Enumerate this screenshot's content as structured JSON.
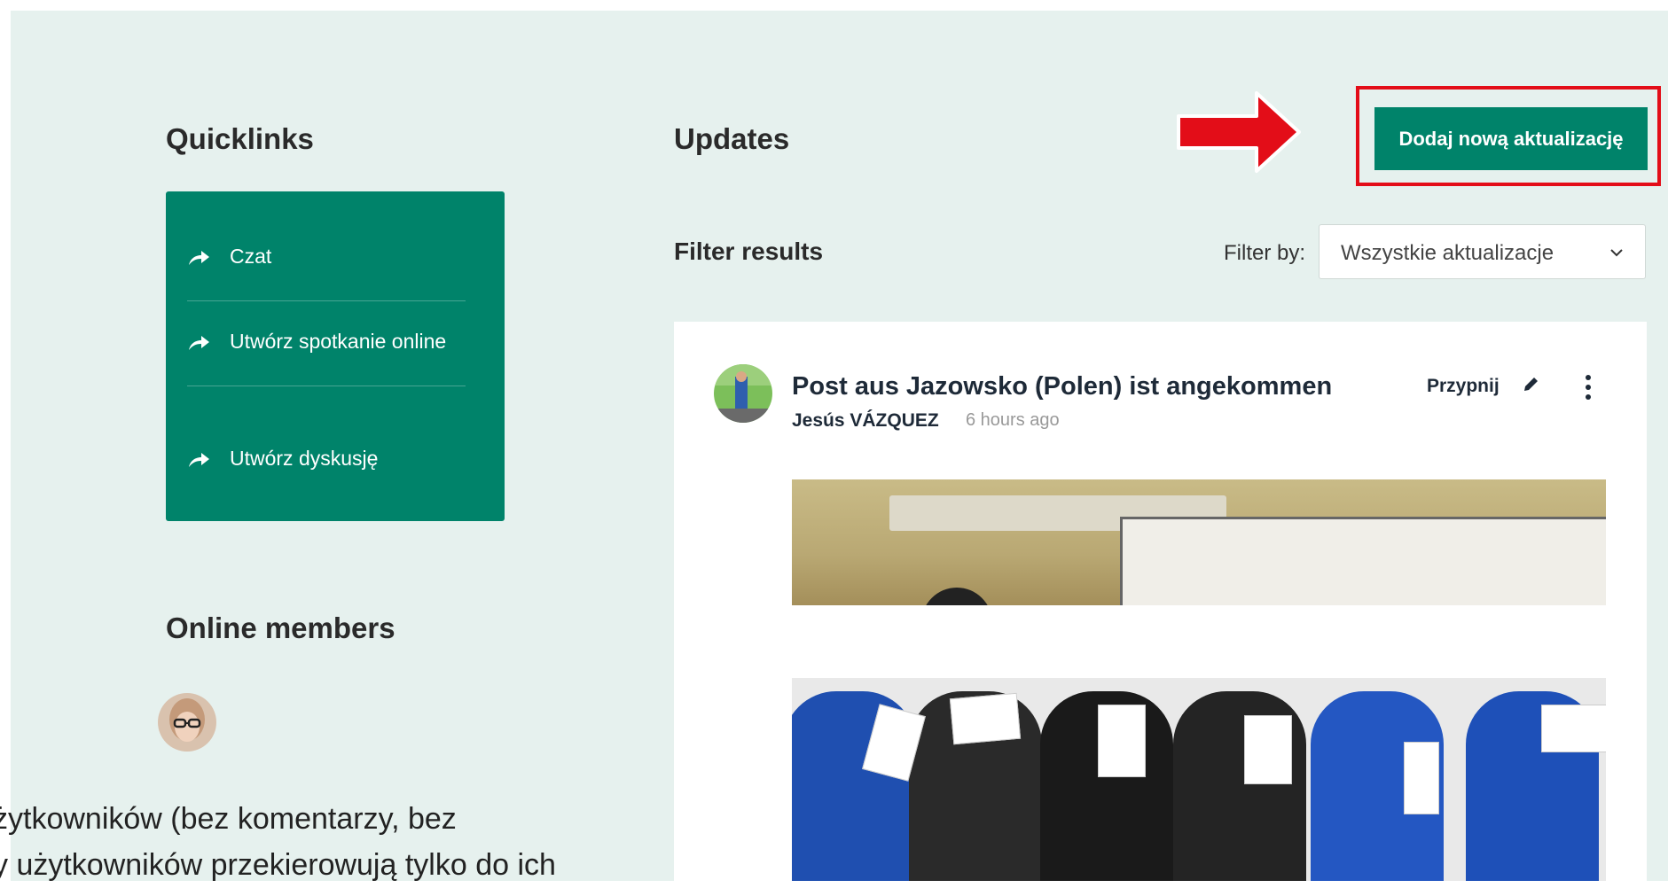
{
  "colors": {
    "accent": "#00836a",
    "highlight": "#e30d18",
    "background": "#e6f1ee"
  },
  "quicklinks": {
    "title": "Quicklinks",
    "items": [
      {
        "label": "Czat",
        "icon": "share-arrow-icon"
      },
      {
        "label": "Utwórz spotkanie online",
        "icon": "share-arrow-icon"
      },
      {
        "label": "Utwórz dyskusję",
        "icon": "share-arrow-icon"
      }
    ]
  },
  "online_members": {
    "title": "Online members"
  },
  "updates": {
    "title": "Updates",
    "add_button": "Dodaj nową aktualizację",
    "filter": {
      "title": "Filter results",
      "label": "Filter by:",
      "selected": "Wszystkie aktualizacje"
    }
  },
  "post": {
    "title": "Post aus Jazowsko (Polen) ist angekommen",
    "author": "Jesús VÁZQUEZ",
    "time": "6 hours ago",
    "pin_label": "Przypnij"
  },
  "overlay_text": {
    "line1": "żytkowników (bez komentarzy, bez",
    "line2": "y użytkowników przekierowują tylko do ich"
  }
}
